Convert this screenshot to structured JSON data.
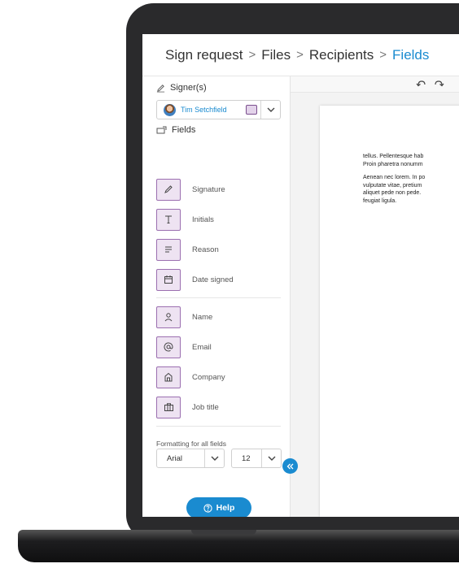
{
  "breadcrumb": {
    "steps": [
      "Sign request",
      "Files",
      "Recipients",
      "Fields"
    ],
    "separator": ">",
    "active_color": "#1a8bd0"
  },
  "sidebar": {
    "signers_heading": "Signer(s)",
    "signer": {
      "name": "Tim Setchfield",
      "color": "#e3d3ea"
    },
    "fields_heading": "Fields",
    "fields_group_1": [
      {
        "label": "Signature",
        "icon": "pen-icon"
      },
      {
        "label": "Initials",
        "icon": "text-t-icon"
      },
      {
        "label": "Reason",
        "icon": "lines-icon"
      },
      {
        "label": "Date signed",
        "icon": "calendar-icon"
      }
    ],
    "fields_group_2": [
      {
        "label": "Name",
        "icon": "person-icon"
      },
      {
        "label": "Email",
        "icon": "at-icon"
      },
      {
        "label": "Company",
        "icon": "building-icon"
      },
      {
        "label": "Job title",
        "icon": "briefcase-icon"
      }
    ],
    "formatting_label": "Formatting for all fields",
    "font_value": "Arial",
    "size_value": "12",
    "help_label": "Help"
  },
  "document": {
    "lines_1": [
      "tellus. Pellentesque hab",
      "Proin pharetra nonumm"
    ],
    "lines_2": [
      "Aenean nec lorem. In po",
      "vulputate vitae, pretium",
      "aliquet pede non pede.",
      "feugiat ligula."
    ]
  },
  "colors": {
    "accent": "#1a8bd0",
    "field_tile_bg": "#eee3f2",
    "field_tile_border": "#9b6fb0"
  }
}
